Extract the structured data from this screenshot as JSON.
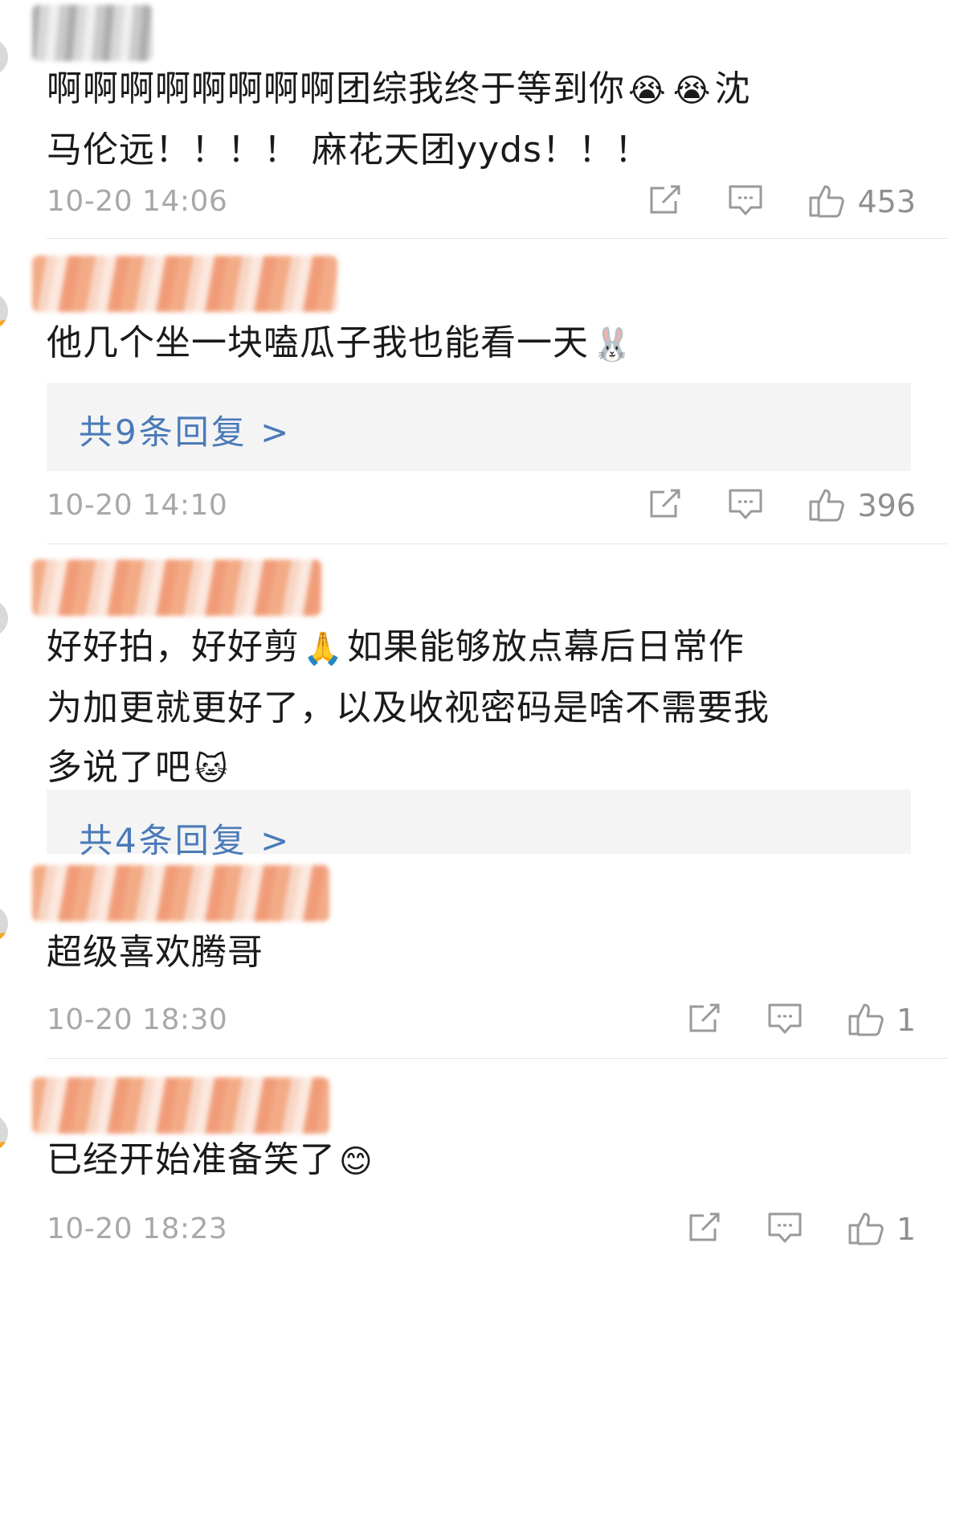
{
  "comments": [
    {
      "text_line1": "啊啊啊啊啊啊啊啊团综我终于等到你",
      "text_line1_tail": "沈",
      "text_line2": "马伦远！！！！ 麻花天团yyds！！！",
      "emoji_1": "crying-face-icon",
      "emoji_2": "crying-face-icon",
      "time": "10-20 14:06",
      "likes": "453"
    },
    {
      "text": "他几个坐一块嗑瓜子我也能看一天",
      "emoji": "bunny-face-icon",
      "replies": "共9条回复 >",
      "time": "10-20 14:10",
      "likes": "396"
    },
    {
      "text_line1": "好好拍，好好剪",
      "text_line1_tail": "如果能够放点幕后日常作",
      "text_line2": "为加更就更好了，以及收视密码是啥不需要我",
      "text_line3": "多说了吧",
      "emoji_1": "folded-hands-icon",
      "emoji_2": "cat-face-icon",
      "replies": "共4条回复 >"
    },
    {
      "text": "超级喜欢腾哥",
      "time": "10-20 18:30",
      "likes": "1"
    },
    {
      "text": "已经开始准备笑了",
      "emoji": "blushing-face-icon",
      "time": "10-20 18:23",
      "likes": "1"
    }
  ],
  "colors": {
    "text": "#1a1a1a",
    "meta": "#a8a8a8",
    "link": "#4a7ab8",
    "reply_bg": "#f4f4f4",
    "divider": "#e6e6e6"
  }
}
